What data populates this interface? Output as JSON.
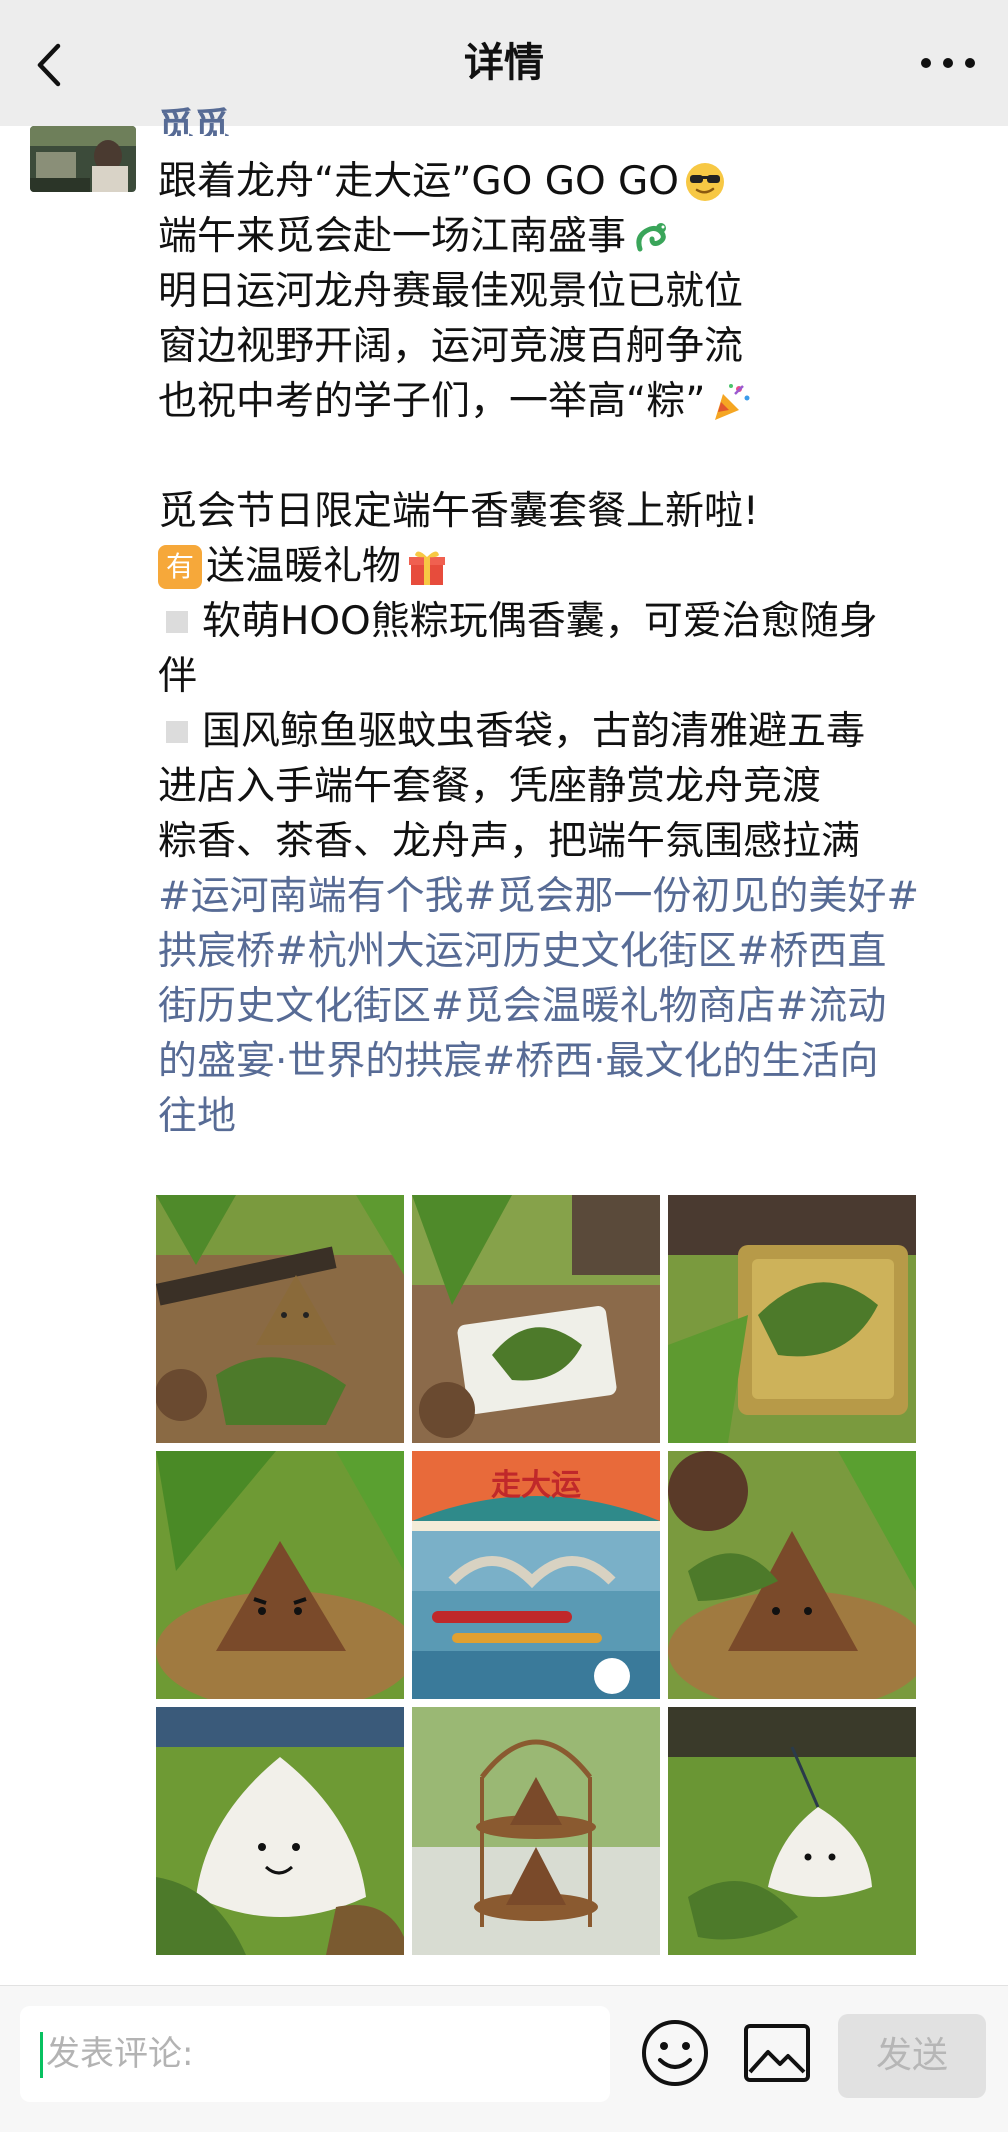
{
  "header": {
    "title": "详情",
    "back_icon": "chevron-left-icon",
    "more_icon": "more-dots-icon"
  },
  "author": {
    "name": "觅觅"
  },
  "post": {
    "lines": [
      "跟着龙舟“走大运”GO GO GO",
      "端午来觅会赴一场江南盛事",
      "明日运河龙舟赛最佳观景位已就位",
      "窗边视野开阔，运河竞渡百舸争流",
      "也祝中考的学子们，一举高“粽”",
      "觅会节日限定端午香囊套餐上新啦!",
      "送温暖礼物",
      "软萌HOO熊粽玩偶香囊，可爱治愈随身",
      "伴",
      "国风鲸鱼驱蚊虫香袋，古韵清雅避五毒",
      "进店入手端午套餐，凭座静赏龙舟竞渡",
      "粽香、茶香、龙舟声，把端午氛围感拉满"
    ],
    "you_badge": "有",
    "hashtag_lines": [
      "#运河南端有个我#觅会那一份初见的美好#",
      "拱宸桥#杭州大运河历史文化街区#桥西直",
      "街历史文化街区#觅会温暖礼物商店#流动",
      "的盛宴·世界的拱宸#桥西·最文化的生活向",
      "往地"
    ]
  },
  "photos": {
    "poster_title": "走大运"
  },
  "comment_bar": {
    "placeholder": "发表评论:",
    "send_label": "发送",
    "emoji_icon": "smiley-icon",
    "image_icon": "image-icon"
  },
  "colors": {
    "link": "#576b95",
    "header_bg": "#ededed",
    "caret": "#07c160"
  }
}
